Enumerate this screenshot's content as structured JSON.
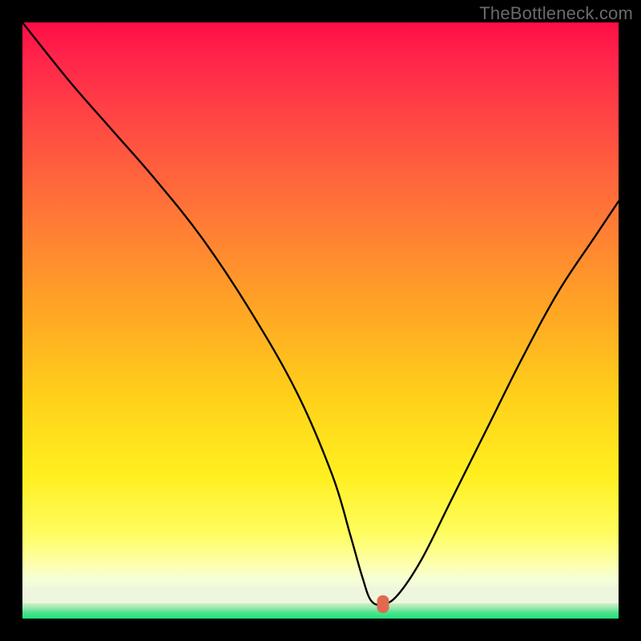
{
  "watermark": {
    "text": "TheBottleneck.com"
  },
  "marker": {
    "x_pct": 60.5,
    "y_pct": 97.6,
    "color": "#e06a50"
  },
  "chart_data": {
    "type": "line",
    "title": "",
    "xlabel": "",
    "ylabel": "",
    "xlim": [
      0,
      100
    ],
    "ylim": [
      0,
      100
    ],
    "grid": false,
    "legend": false,
    "series": [
      {
        "name": "bottleneck-curve",
        "x": [
          0,
          8,
          15,
          22,
          30,
          38,
          46,
          52,
          55,
          57,
          58.5,
          60.5,
          63,
          67,
          72,
          78,
          84,
          90,
          96,
          100
        ],
        "y": [
          100,
          90,
          82,
          74,
          64,
          52,
          38,
          24,
          14,
          7,
          3,
          2.4,
          4,
          10,
          20,
          32,
          44,
          55,
          64,
          70
        ]
      }
    ],
    "annotations": [
      {
        "type": "marker",
        "x": 60.5,
        "y": 2.4,
        "label": "optimal-point"
      }
    ],
    "background_gradient": {
      "stops": [
        {
          "pct": 0,
          "color": "#ff0e46"
        },
        {
          "pct": 18,
          "color": "#ff4a43"
        },
        {
          "pct": 34,
          "color": "#ff7a36"
        },
        {
          "pct": 50,
          "color": "#ffa724"
        },
        {
          "pct": 65,
          "color": "#ffd21a"
        },
        {
          "pct": 78,
          "color": "#ffef20"
        },
        {
          "pct": 88,
          "color": "#fffd60"
        },
        {
          "pct": 96,
          "color": "#f5ffd8"
        },
        {
          "pct": 100,
          "color": "#1fe27a"
        }
      ]
    }
  }
}
